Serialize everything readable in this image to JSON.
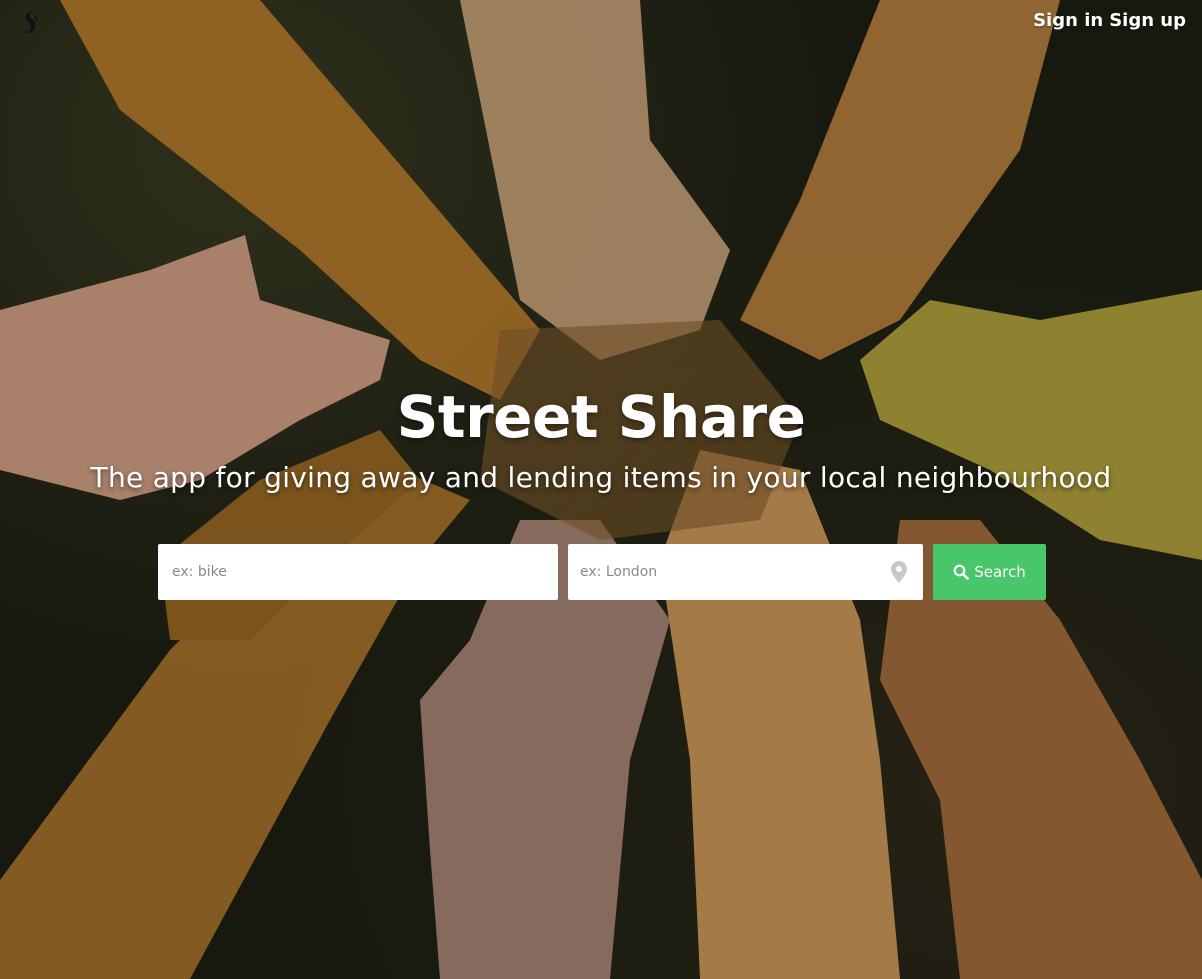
{
  "brand": {
    "logo_icon": "street-share-logo-icon"
  },
  "nav": {
    "sign_in": "Sign in",
    "sign_up": "Sign up"
  },
  "hero": {
    "title": "Street Share",
    "subtitle": "The app for giving away and lending items in your local neighbourhood"
  },
  "search": {
    "item_placeholder": "ex: bike",
    "location_placeholder": "ex: London",
    "location_icon": "map-pin-icon",
    "button_icon": "search-icon",
    "button_label": "Search"
  },
  "colors": {
    "search_button": "#49c56a",
    "text": "#ffffff",
    "input_background": "#ffffff"
  }
}
